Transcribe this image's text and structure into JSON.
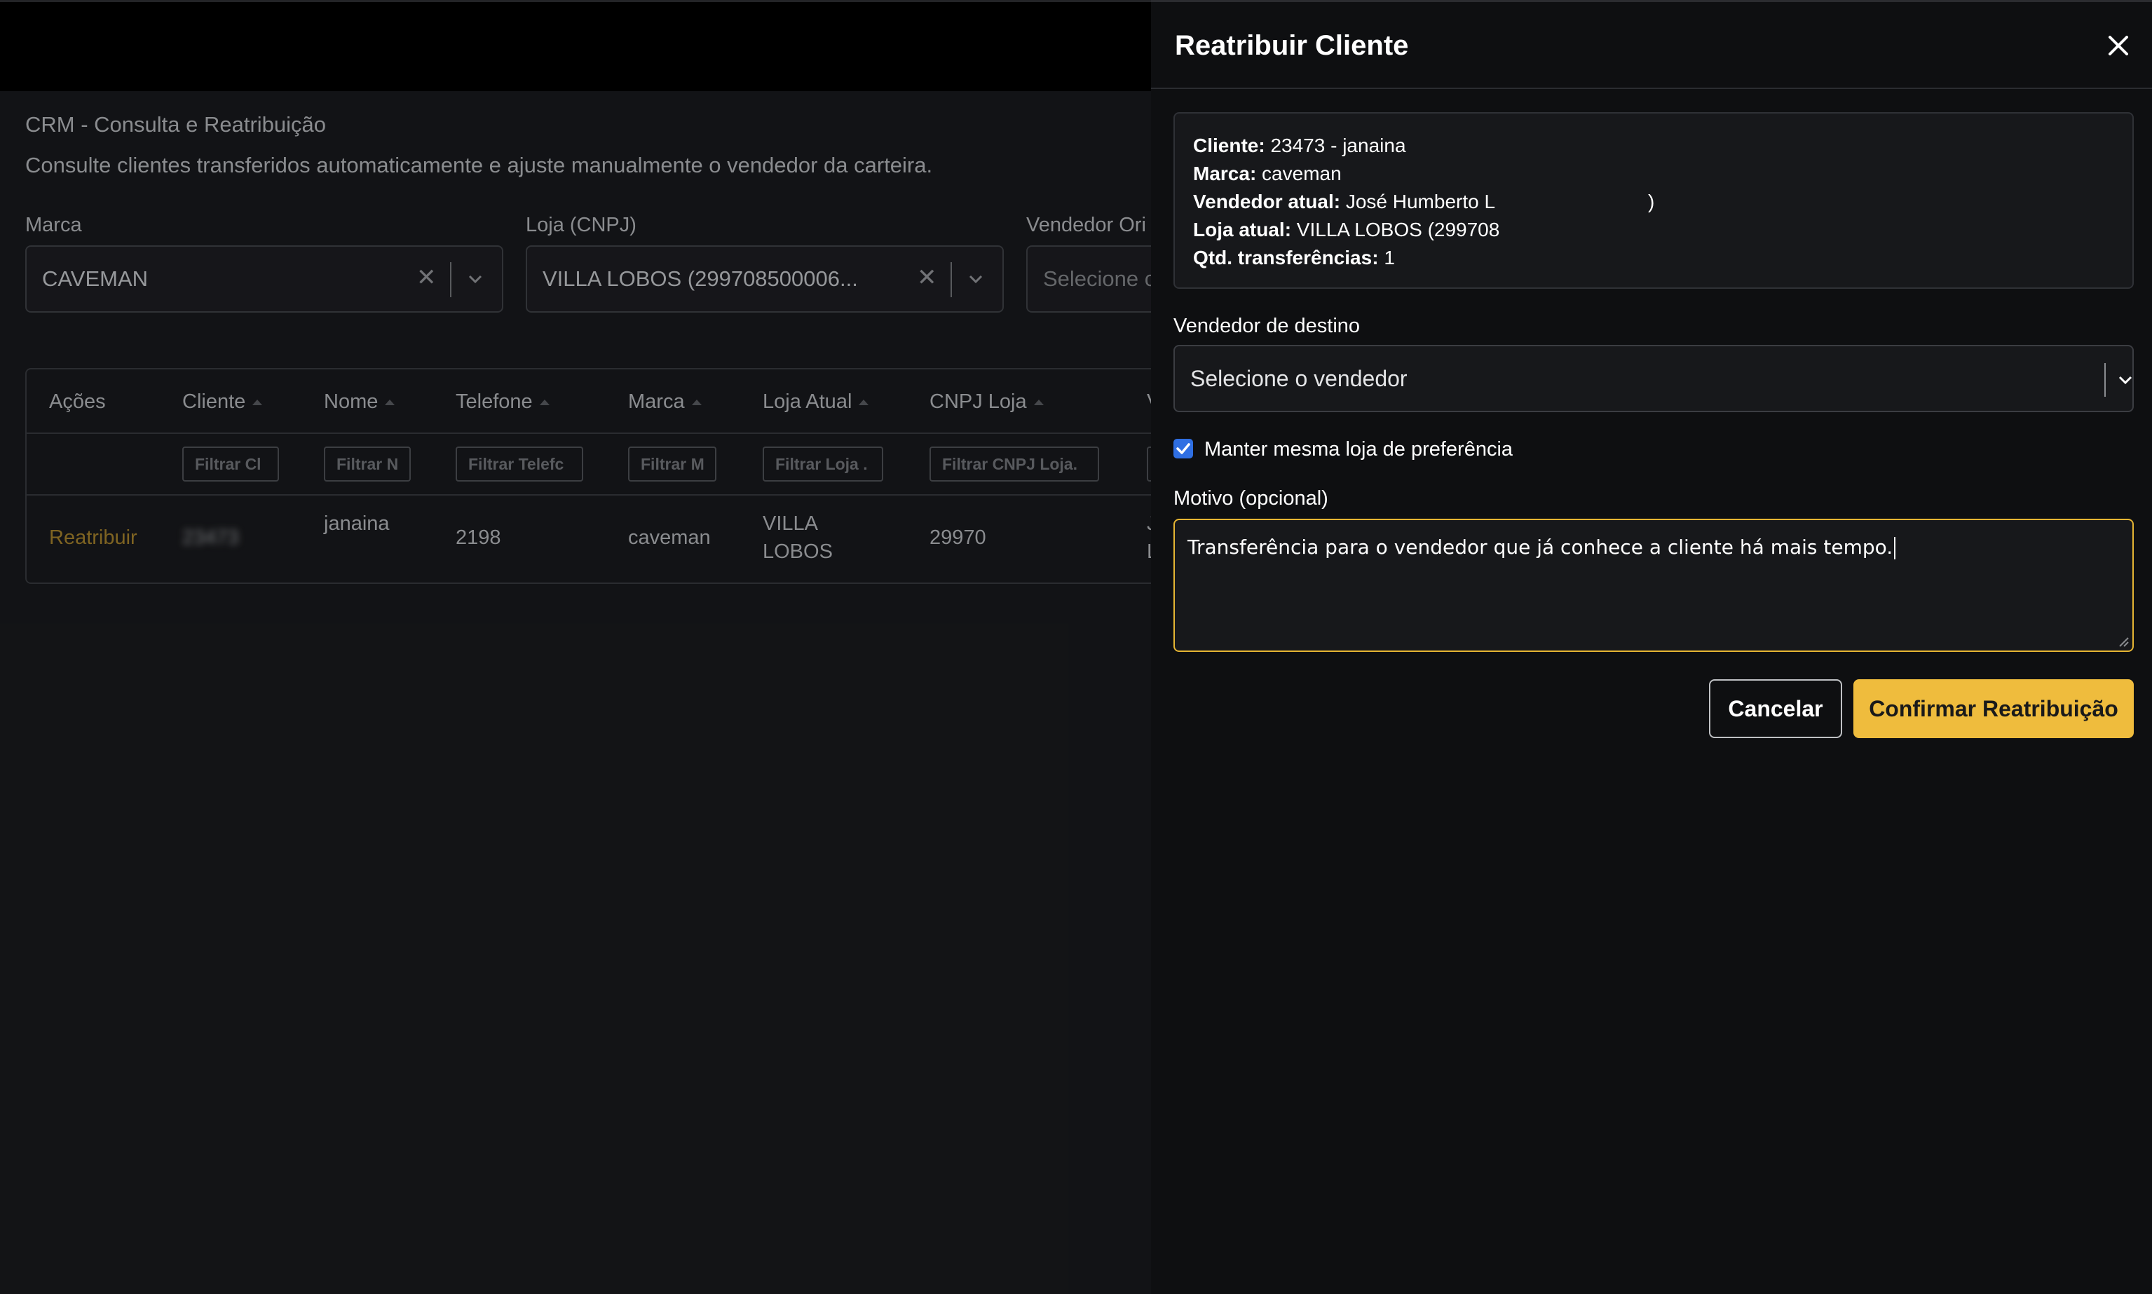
{
  "page": {
    "title": "CRM - Consulta e Reatribuição",
    "description": "Consulte clientes transferidos automaticamente e ajuste manualmente o vendedor da carteira."
  },
  "filters": {
    "marca": {
      "label": "Marca",
      "value": "CAVEMAN"
    },
    "loja": {
      "label": "Loja (CNPJ)",
      "value": "VILLA LOBOS (299708500006..."
    },
    "vendedor": {
      "label": "Vendedor Ori",
      "placeholder": "Selecione c"
    }
  },
  "table": {
    "columns": [
      "Ações",
      "Cliente",
      "Nome",
      "Telefone",
      "Marca",
      "Loja Atual",
      "CNPJ Loja",
      "V"
    ],
    "filters": [
      "Filtrar Cl",
      "Filtrar N",
      "Filtrar Telefc",
      "Filtrar M",
      "Filtrar Loja .",
      "Filtrar CNPJ Loja."
    ],
    "rows": [
      {
        "action": "Reatribuir",
        "cliente": "23473",
        "nome": "janaina",
        "telefone": "2198",
        "marca": "caveman",
        "loja_line1": "VILLA",
        "loja_line2": "LOBOS",
        "cnpj": "29970",
        "vendedor_line1": "J",
        "vendedor_line2": "L"
      }
    ]
  },
  "panel": {
    "title": "Reatribuir Cliente",
    "info": {
      "cliente_label": "Cliente:",
      "cliente_value": "23473 - janaina",
      "marca_label": "Marca:",
      "marca_value": "caveman",
      "vendedor_label": "Vendedor atual:",
      "vendedor_value": "José Humberto L",
      "vendedor_suffix": ")",
      "loja_label": "Loja atual:",
      "loja_value": "VILLA LOBOS (299708",
      "qtd_label": "Qtd. transferências:",
      "qtd_value": "1"
    },
    "destino_label": "Vendedor de destino",
    "destino_placeholder": "Selecione o vendedor",
    "checkbox_label": "Manter mesma loja de preferência",
    "checkbox_checked": true,
    "motivo_label": "Motivo (opcional)",
    "motivo_value": "Transferência para o vendedor que já conhece a cliente há mais tempo.",
    "cancel_label": "Cancelar",
    "confirm_label": "Confirmar Reatribuição"
  },
  "colors": {
    "accent": "#efbc3d",
    "link": "#9b7a2a",
    "checkbox": "#2f6fe3",
    "focus_border": "#e5b533"
  }
}
